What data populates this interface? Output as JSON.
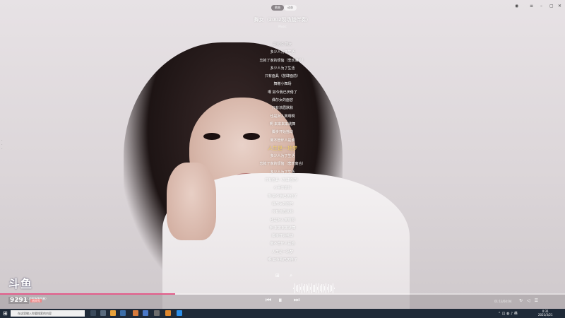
{
  "header": {
    "tabs": [
      {
        "label": "歌曲"
      },
      {
        "label": "动态"
      }
    ],
    "song_title": "舞女（2002现场版伴奏）",
    "artist": "Music"
  },
  "lyrics": [
    "歌坊说  舞女",
    "多少人为了生活",
    "忘掉了家的烦恼（悲欢离合）",
    "多少人为了生活",
    "只有面具（放肆面前）",
    "舞榭小舞场",
    "啊  如今我已厌倦了",
    "偶尔女的面容",
    "只有浓眉默默",
    "也是对人笑啊啊",
    "啊  来来来来跳舞",
    "脚步开始摇动",
    "离不管坏人是谁",
    "人生是一场梦",
    "多少人为了生活",
    "忘掉了家的烦恼（悲欢离合）",
    "多少人为了生活",
    "只有面具（放肆面前）",
    "心事向谁诉",
    "啊  如今我已厌倦了",
    "偶尔女的面容",
    "只有浓眉默默",
    "也是对人笑啊啊",
    "啊  来来来来跳舞",
    "脚步开始摇动",
    "离不管坏人是谁",
    "人生是一场梦",
    "啊  如今我已厌倦了"
  ],
  "current_lyric_index": 13,
  "player": {
    "mini_title": "舞女（2002现场版伴奏）",
    "time": "01:13/04:04",
    "progress": 0.31,
    "prev_icon": "previous-icon",
    "play_icon": "pause-icon",
    "next_icon": "next-icon"
  },
  "overlay": {
    "logo": "斗鱼",
    "room": "9291",
    "room_label": "房间号",
    "id_label": "ID"
  },
  "taskbar": {
    "search_placeholder": "在这里输入你要搜索的内容",
    "clock_time": "0:31",
    "clock_date": "2021/3/21"
  },
  "colors": {
    "accent": "#e35c8a",
    "current_lyric": "#f7d46a",
    "taskbar": "#1f2a38"
  }
}
